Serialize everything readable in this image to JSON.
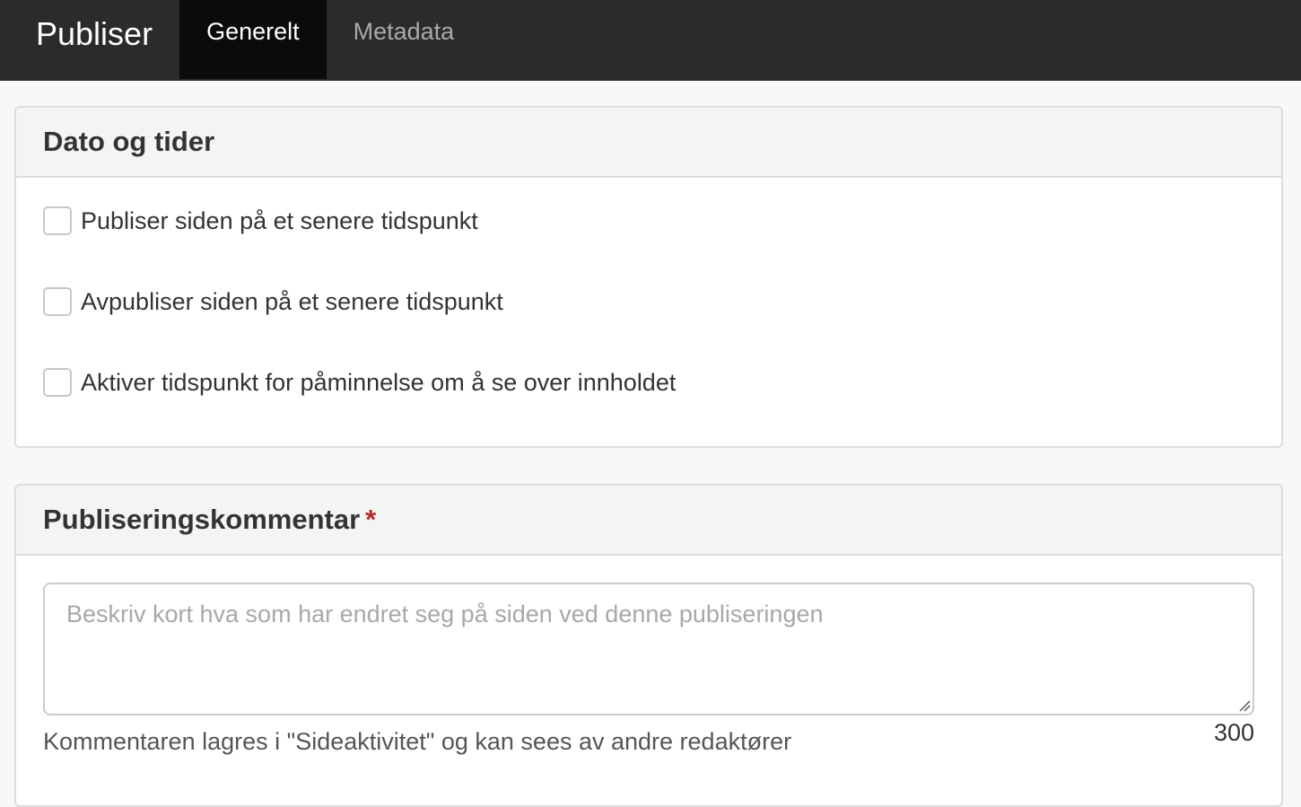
{
  "header": {
    "title": "Publiser",
    "tabs": [
      {
        "label": "Generelt",
        "active": true
      },
      {
        "label": "Metadata",
        "active": false
      }
    ]
  },
  "dates_panel": {
    "heading": "Dato og tider",
    "options": [
      {
        "label": "Publiser siden på et senere tidspunkt",
        "checked": false
      },
      {
        "label": "Avpubliser siden på et senere tidspunkt",
        "checked": false
      },
      {
        "label": "Aktiver tidspunkt for påminnelse om å se over innholdet",
        "checked": false
      }
    ]
  },
  "comment_panel": {
    "heading": "Publiseringskommentar",
    "required_mark": "*",
    "placeholder": "Beskriv kort hva som har endret seg på siden ved denne publiseringen",
    "value": "",
    "help_text": "Kommentaren lagres i \"Sideaktivitet\" og kan sees av andre redaktører",
    "char_remaining": "300"
  },
  "colors": {
    "topbar": "#2b2b2b",
    "active_tab": "#0b0b0b",
    "required": "#b52b27"
  }
}
